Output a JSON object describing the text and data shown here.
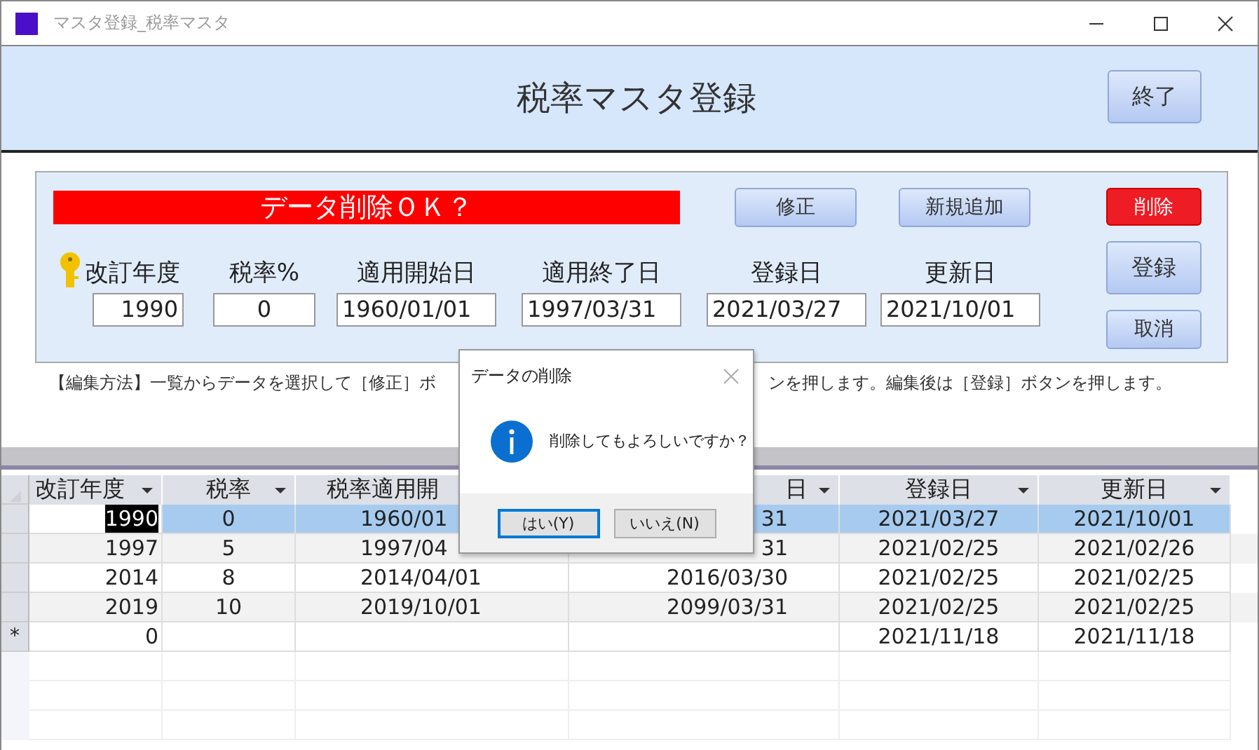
{
  "window": {
    "title": "マスタ登録_税率マスタ"
  },
  "header": {
    "title": "税率マスタ登録",
    "exit_button": "終了"
  },
  "form": {
    "status_banner": "データ削除ＯＫ？",
    "top_buttons": [
      {
        "label": "修正"
      },
      {
        "label": "新規追加"
      }
    ],
    "side_buttons": [
      {
        "label": "削除",
        "kind": "danger"
      },
      {
        "label": "登録",
        "kind": "normal"
      },
      {
        "label": "取消",
        "kind": "normal"
      }
    ],
    "fields": [
      {
        "label": "改訂年度",
        "value": "1990",
        "kind": "year",
        "key": true
      },
      {
        "label": "税率%",
        "value": "0",
        "kind": "rate",
        "key": false
      },
      {
        "label": "適用開始日",
        "value": "1960/01/01",
        "kind": "date",
        "key": false
      },
      {
        "label": "適用終了日",
        "value": "1997/03/31",
        "kind": "date",
        "key": false
      },
      {
        "label": "登録日",
        "value": "2021/03/27",
        "kind": "date",
        "key": false
      },
      {
        "label": "更新日",
        "value": "2021/10/01",
        "kind": "date",
        "key": false
      }
    ]
  },
  "instructions": [
    "【編集方法】一覧からデータを選択して［修正］ボ",
    "ンを押します。編集後は［登録］ボタンを押します。"
  ],
  "grid": {
    "columns": [
      {
        "label": "改訂年度",
        "menu": true
      },
      {
        "label": "税率",
        "menu": true
      },
      {
        "label": "税率適用開",
        "menu": false
      },
      {
        "label": "日",
        "menu": true
      },
      {
        "label": "登録日",
        "menu": true
      },
      {
        "label": "更新日",
        "menu": true
      }
    ],
    "rows": [
      {
        "selected": true,
        "marker": null,
        "cells": [
          "1990",
          "0",
          "1960/01",
          "31",
          "2021/03/27",
          "2021/10/01"
        ]
      },
      {
        "selected": false,
        "marker": null,
        "cells": [
          "1997",
          "5",
          "1997/04",
          "31",
          "2021/02/25",
          "2021/02/26"
        ]
      },
      {
        "selected": false,
        "marker": null,
        "cells": [
          "2014",
          "8",
          "2014/04/01",
          "2016/03/30",
          "2021/02/25",
          "2021/02/25"
        ]
      },
      {
        "selected": false,
        "marker": null,
        "cells": [
          "2019",
          "10",
          "2019/10/01",
          "2099/03/31",
          "2021/02/25",
          "2021/02/25"
        ]
      },
      {
        "selected": false,
        "marker": "*",
        "cells": [
          "0",
          null,
          null,
          null,
          "2021/11/18",
          "2021/11/18"
        ]
      }
    ]
  },
  "dialog": {
    "title": "データの削除",
    "message": "削除してもよろしいですか？",
    "buttons": [
      {
        "label": "はい(Y)",
        "selected": true
      },
      {
        "label": "いいえ(N)",
        "selected": false
      }
    ]
  }
}
